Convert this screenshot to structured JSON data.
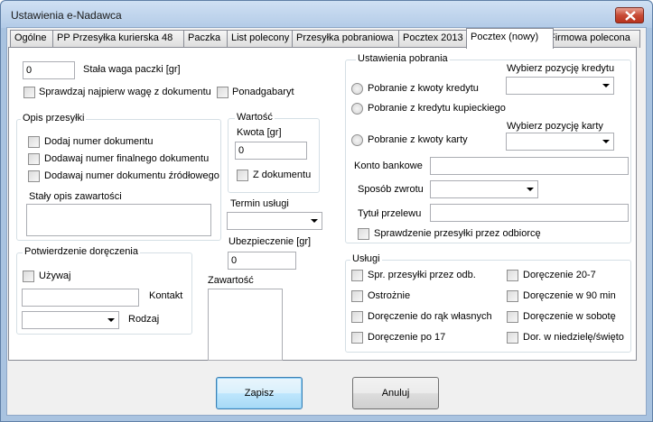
{
  "window": {
    "title": "Ustawienia e-Nadawca"
  },
  "tabs": [
    {
      "label": "Ogólne"
    },
    {
      "label": "PP Przesyłka kurierska 48"
    },
    {
      "label": "Paczka"
    },
    {
      "label": "List polecony"
    },
    {
      "label": "Przesyłka pobraniowa"
    },
    {
      "label": "Pocztex 2013"
    },
    {
      "label": "Pocztex (nowy)"
    },
    {
      "label": "Firmowa polecona"
    }
  ],
  "top": {
    "weight_value": "0",
    "weight_label": "Stała waga paczki [gr]",
    "check_weight_label": "Sprawdzaj najpierw wagę z dokumentu",
    "oversize_label": "Ponadgabaryt"
  },
  "opis": {
    "title": "Opis przesyłki",
    "add_doc": "Dodaj numer dokumentu",
    "add_final": "Dodawaj numer finalnego dokumentu",
    "add_source": "Dodawaj numer dokumentu źródłowego",
    "contents_label": "Stały opis zawartości",
    "contents_value": ""
  },
  "wartosc": {
    "title": "Wartość",
    "amount_label": "Kwota [gr]",
    "amount_value": "0",
    "from_doc": "Z dokumentu"
  },
  "termin": {
    "label": "Termin usługi",
    "value": ""
  },
  "ubezpieczenie": {
    "label": "Ubezpieczenie [gr]",
    "value": "0"
  },
  "zawartosc": {
    "label": "Zawartość",
    "value": ""
  },
  "potwierdzenie": {
    "title": "Potwierdzenie doręczenia",
    "use_label": "Używaj",
    "contact_label": "Kontakt",
    "contact_value": "",
    "type_label": "Rodzaj",
    "type_value": ""
  },
  "pobranie": {
    "title": "Ustawienia pobrania",
    "credit_pick_label": "Wybierz pozycję kredytu",
    "card_pick_label": "Wybierz pozycję karty",
    "opt_credit": "Pobranie z kwoty kredytu",
    "opt_merchant": "Pobranie z kredytu kupieckiego",
    "opt_card": "Pobranie z kwoty karty",
    "account_label": "Konto bankowe",
    "account_value": "",
    "refund_label": "Sposób zwrotu",
    "refund_value": "",
    "transfer_label": "Tytuł przelewu",
    "transfer_value": "",
    "check_by_recipient": "Sprawdzenie przesyłki przez odbiorcę"
  },
  "uslugi": {
    "title": "Usługi",
    "left": [
      "Spr. przesyłki przez odb.",
      "Ostrożnie",
      "Doręczenie do rąk własnych",
      "Doręczenie po 17"
    ],
    "right": [
      "Doręczenie 20-7",
      "Doręczenie w 90 min",
      "Doręczenie w sobotę",
      "Dor. w niedzielę/święto"
    ]
  },
  "buttons": {
    "save": "Zapisz",
    "cancel": "Anuluj"
  }
}
